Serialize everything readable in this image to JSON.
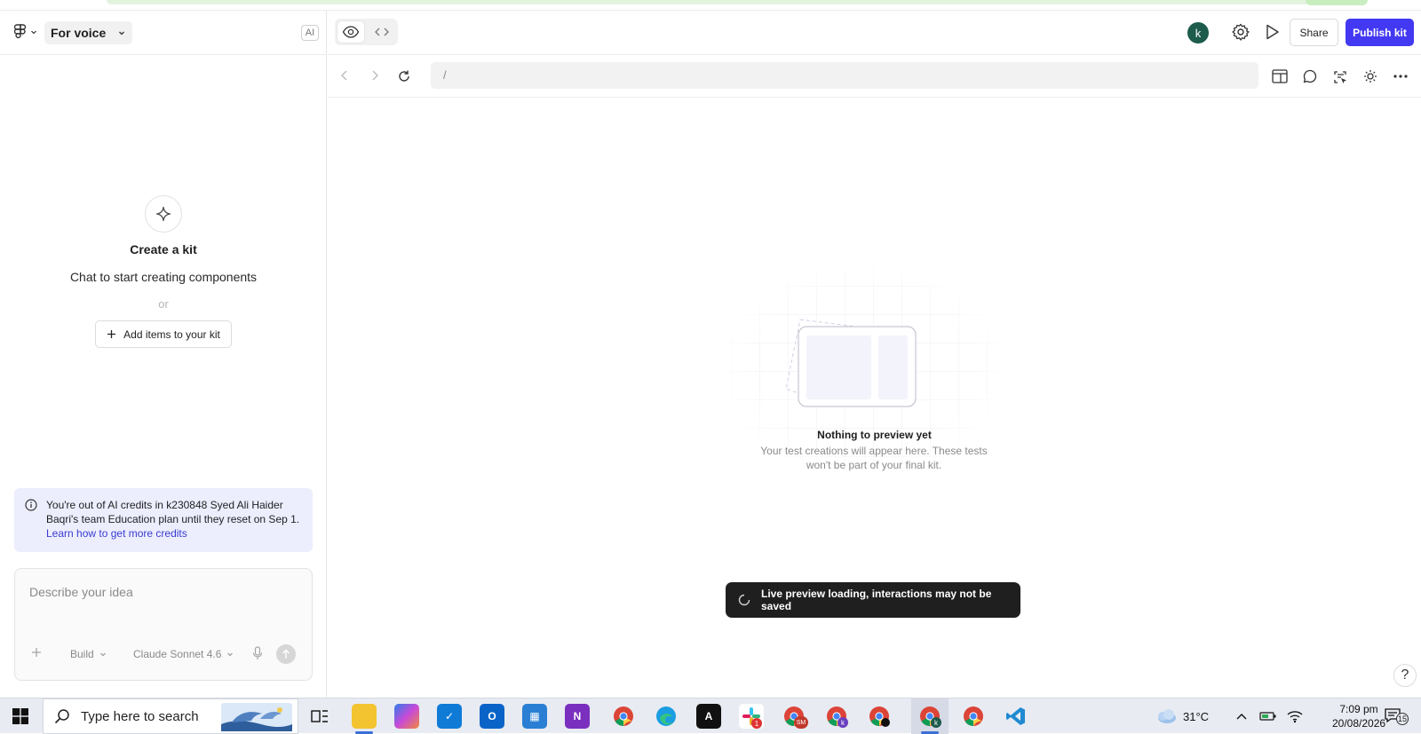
{
  "left_panel": {
    "project_name": "For voice",
    "ai_badge": "AI",
    "empty": {
      "title": "Create a kit",
      "subtitle": "Chat to start creating components",
      "or": "or",
      "add_items": "Add items to your kit"
    },
    "notice": {
      "text": "You're out of AI credits in k230848 Syed Ali Haider Baqri's team Education plan until they reset on Sep 1.",
      "link": "Learn how to get more credits"
    },
    "composer": {
      "placeholder": "Describe your idea",
      "mode": "Build",
      "model": "Claude Sonnet 4.6"
    }
  },
  "toolbar": {
    "avatar_letter": "k",
    "share": "Share",
    "publish": "Publish kit"
  },
  "urlbar": {
    "path": "/"
  },
  "preview": {
    "empty_title": "Nothing to preview yet",
    "empty_subtitle": "Your test creations will appear here. These tests won't be part of your final kit.",
    "toast": "Live preview loading, interactions may not be saved",
    "help": "?"
  },
  "taskbar": {
    "search_placeholder": "Type here to search",
    "weather": "31°C",
    "time": "7:09 pm",
    "date": "20/08/2026",
    "notification_count": "15",
    "slack_badge": "1",
    "chrome_profile_1": "SM",
    "chrome_profile_2": "k",
    "chrome_profile_3": "k"
  },
  "colors": {
    "accent": "#4339f2",
    "notice_bg": "#eceefe",
    "link": "#3b3bd1",
    "toast_bg": "#1f1f1f",
    "avatar_bg": "#1d5b4c"
  }
}
